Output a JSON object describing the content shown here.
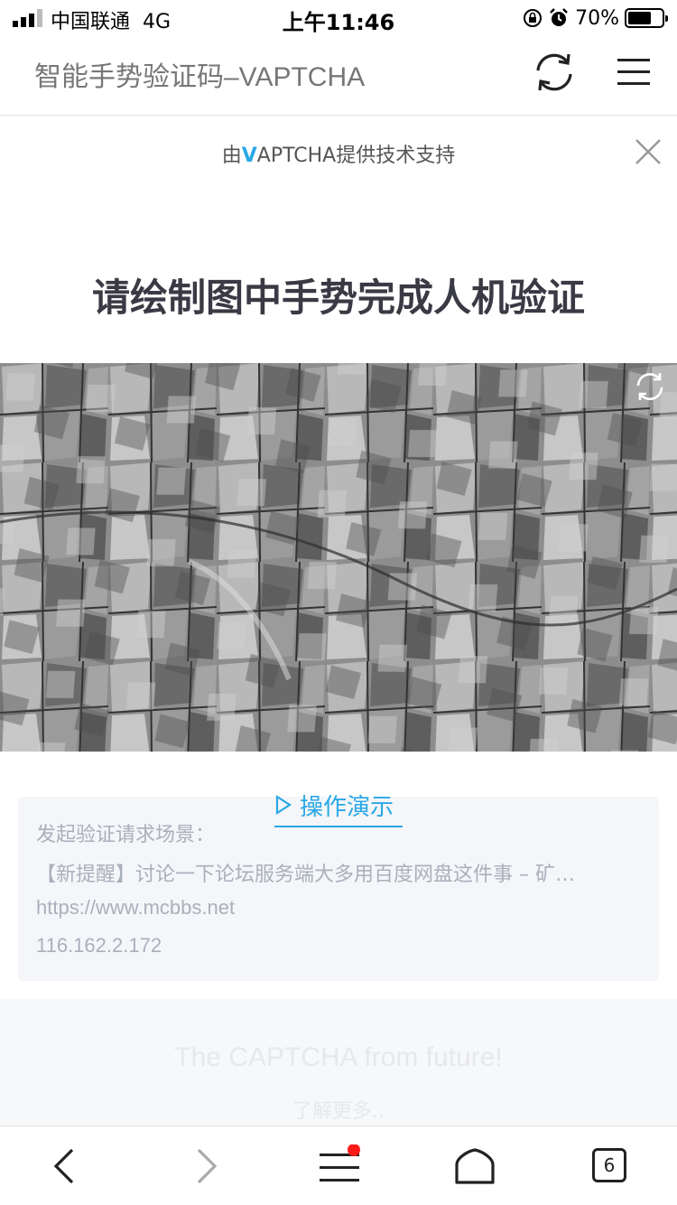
{
  "status_bar": {
    "carrier": "中国联通",
    "network": "4G",
    "time": "上午11:46",
    "battery_percent": "70%",
    "battery_level": 0.7
  },
  "browser": {
    "page_title": "智能手势验证码–VAPTCHA",
    "tab_count": "6"
  },
  "captcha": {
    "banner_prefix": "由",
    "banner_brand_v": "V",
    "banner_brand_rest": "APTCHA",
    "banner_suffix": "提供技术支持",
    "headline": "请绘制图中手势完成人机验证",
    "demo_label": "操作演示",
    "info": {
      "label": "发起验证请求场景：",
      "title": "【新提醒】讨论一下论坛服务端大多用百度网盘这件事 – 矿…",
      "url": "https://www.mcbbs.net",
      "ip": "116.162.2.172"
    },
    "tagline": "The CAPTCHA from future!",
    "learn_more": "了解更多.."
  },
  "colors": {
    "accent": "#2aa8e6",
    "notification_dot": "#ff1a1a"
  }
}
